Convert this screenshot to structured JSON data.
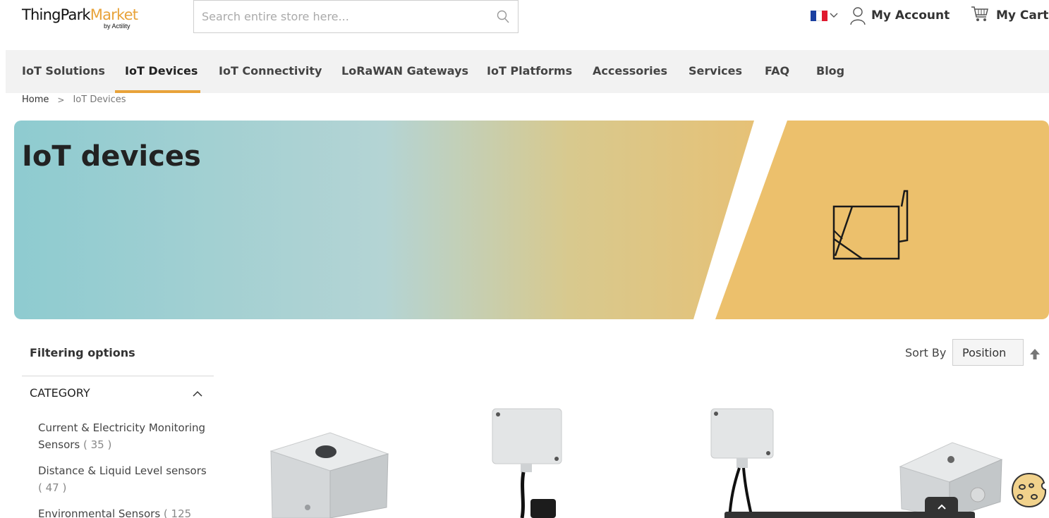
{
  "header": {
    "logo": {
      "brand_main": "ThingPark",
      "brand_accent": "Market",
      "brand_sub": "by Actility"
    },
    "search": {
      "placeholder": "Search entire store here...",
      "icon": "search-icon"
    },
    "language": {
      "icon": "france-flag-icon"
    },
    "account_label": "My Account",
    "cart_label": "My Cart"
  },
  "nav": {
    "items": [
      {
        "label": "IoT Solutions"
      },
      {
        "label": "IoT Devices",
        "active": true
      },
      {
        "label": "IoT Connectivity"
      },
      {
        "label": "LoRaWAN Gateways"
      },
      {
        "label": "IoT Platforms"
      },
      {
        "label": "Accessories"
      },
      {
        "label": "Services"
      },
      {
        "label": "FAQ"
      },
      {
        "label": "Blog"
      }
    ]
  },
  "breadcrumb": {
    "home": "Home",
    "separator": ">",
    "current": "IoT Devices"
  },
  "banner": {
    "title": "IoT devices"
  },
  "filters": {
    "title": "Filtering options",
    "category": {
      "title": "CATEGORY",
      "items": [
        {
          "label": "Current & Electricity Monitoring Sensors",
          "count": "( 35 )"
        },
        {
          "label": "Distance & Liquid Level sensors",
          "count": "( 47 )"
        },
        {
          "label": "Environmental Sensors",
          "count": "( 125"
        }
      ]
    }
  },
  "sort": {
    "label": "Sort By",
    "selected": "Position"
  },
  "colors": {
    "accent": "#e8a33a",
    "banner_teal": "#8ecbd0",
    "banner_gold": "#ecc06c",
    "nav_bg": "#f2f2f2"
  }
}
